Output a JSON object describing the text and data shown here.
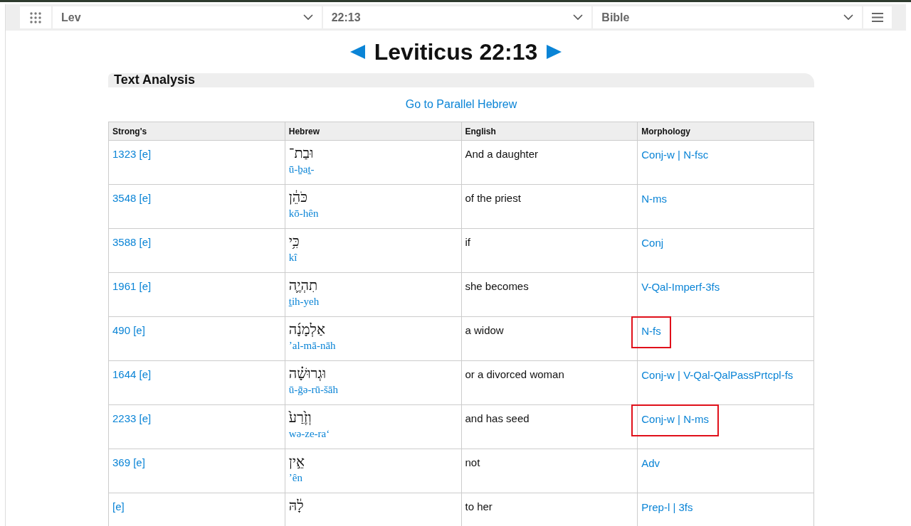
{
  "nav": {
    "book": "Lev",
    "verse": "22:13",
    "version": "Bible"
  },
  "title": "Leviticus 22:13",
  "section_title": "Text Analysis",
  "parallel_link": "Go to Parallel Hebrew",
  "table": {
    "columns": [
      "Strong's",
      "Hebrew",
      "English",
      "Morphology"
    ],
    "rows": [
      {
        "strongs": "1323 [e]",
        "hebrew": "וּבַת־",
        "translit": "ū-ḇaṯ-",
        "english": "And a daughter",
        "morphology": "Conj-w | N-fsc",
        "highlighted": false
      },
      {
        "strongs": "3548 [e]",
        "hebrew": "כֹּהֵ֔ן",
        "translit": "kō-hên",
        "english": "of the priest",
        "morphology": "N-ms",
        "highlighted": false
      },
      {
        "strongs": "3588 [e]",
        "hebrew": "כִּ֥י",
        "translit": "kî",
        "english": "if",
        "morphology": "Conj",
        "highlighted": false
      },
      {
        "strongs": "1961 [e]",
        "hebrew": "תִהְיֶ֛ה",
        "translit": "ṯih-yeh",
        "english": "she becomes",
        "morphology": "V-Qal-Imperf-3fs",
        "highlighted": false
      },
      {
        "strongs": "490 [e]",
        "hebrew": "אַלְמָנָ֜ה",
        "translit": "’al-mā-nāh",
        "english": "a widow",
        "morphology": "N-fs",
        "highlighted": true
      },
      {
        "strongs": "1644 [e]",
        "hebrew": "וּגְרוּשָׁ֗ה",
        "translit": "ū-ḡə-rū-šāh",
        "english": "or a divorced woman",
        "morphology": "Conj-w | V-Qal-QalPassPrtcpl-fs",
        "highlighted": false
      },
      {
        "strongs": "2233 [e]",
        "hebrew": "וְזֶ֙רַע֙",
        "translit": "wə-ze-ra‘",
        "english": "and has seed",
        "morphology": "Conj-w | N-ms",
        "highlighted": true
      },
      {
        "strongs": "369 [e]",
        "hebrew": "אֵ֣ין",
        "translit": "’ên",
        "english": "not",
        "morphology": "Adv",
        "highlighted": false
      },
      {
        "strongs": "[e]",
        "hebrew": "לָ֔הּ",
        "english": "to her",
        "morphology": "Prep-l | 3fs",
        "highlighted": false
      }
    ]
  }
}
